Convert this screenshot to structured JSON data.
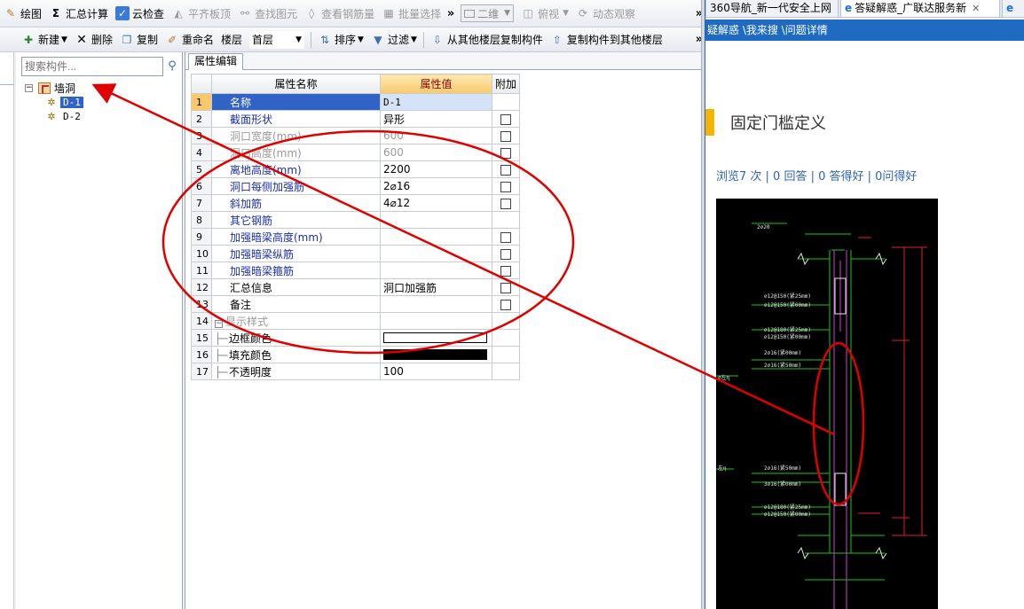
{
  "toolbar_top": {
    "items": [
      {
        "label": "绘图",
        "icon": "draw-icon",
        "enabled": true
      },
      {
        "label": "汇总计算",
        "icon": "sigma-icon",
        "enabled": true
      },
      {
        "label": "云检查",
        "icon": "cloud-check-icon",
        "enabled": true
      },
      {
        "label": "平齐板顶",
        "icon": "align-icon",
        "enabled": false
      },
      {
        "label": "查找图元",
        "icon": "binoculars-icon",
        "enabled": false
      },
      {
        "label": "查看钢筋量",
        "icon": "rebar-icon",
        "enabled": false
      },
      {
        "label": "批量选择",
        "icon": "batch-icon",
        "enabled": false
      }
    ],
    "view_mode": "二维",
    "view_angle": "俯视",
    "dynamic_view": "动态观察",
    "more": "»"
  },
  "toolbar_second": {
    "new_label": "新建",
    "delete_label": "删除",
    "copy_label": "复制",
    "rename_label": "重命名",
    "floor_label": "楼层",
    "floor_value": "首层",
    "sort_label": "排序",
    "filter_label": "过滤",
    "copy_from_label": "从其他楼层复制构件",
    "copy_to_label": "复制构件到其他楼层",
    "more": "»"
  },
  "close_glyph": "✕",
  "search": {
    "placeholder": "搜索构件..."
  },
  "tree": {
    "root_label": "墙洞",
    "children": [
      "D-1",
      "D-2"
    ]
  },
  "tab_label": "属性编辑",
  "grid": {
    "headers": {
      "name": "属性名称",
      "value": "属性值",
      "extra": "附加"
    },
    "rows": [
      {
        "num": "1",
        "name": "名称",
        "value": "D-1",
        "style": "selected",
        "checkbox": false
      },
      {
        "num": "2",
        "name": "截面形状",
        "value": "异形",
        "style": "blue",
        "checkbox": true
      },
      {
        "num": "3",
        "name": "洞口宽度(mm)",
        "value": "600",
        "style": "gray",
        "checkbox": true
      },
      {
        "num": "4",
        "name": "洞口高度(mm)",
        "value": "600",
        "style": "gray",
        "checkbox": true
      },
      {
        "num": "5",
        "name": "离地高度(mm)",
        "value": "2200",
        "style": "blue",
        "checkbox": true
      },
      {
        "num": "6",
        "name": "洞口每侧加强筋",
        "value": "2⌀16",
        "style": "blue",
        "checkbox": true
      },
      {
        "num": "7",
        "name": "斜加筋",
        "value": "4⌀12",
        "style": "blue",
        "checkbox": true
      },
      {
        "num": "8",
        "name": "其它钢筋",
        "value": "",
        "style": "blue",
        "checkbox": false
      },
      {
        "num": "9",
        "name": "加强暗梁高度(mm)",
        "value": "",
        "style": "blue",
        "checkbox": true
      },
      {
        "num": "10",
        "name": "加强暗梁纵筋",
        "value": "",
        "style": "blue",
        "checkbox": true
      },
      {
        "num": "11",
        "name": "加强暗梁箍筋",
        "value": "",
        "style": "blue",
        "checkbox": true
      },
      {
        "num": "12",
        "name": "汇总信息",
        "value": "洞口加强筋",
        "style": "black",
        "checkbox": true
      },
      {
        "num": "13",
        "name": "备注",
        "value": "",
        "style": "black",
        "checkbox": true
      },
      {
        "num": "14",
        "name": "显示样式",
        "value": "",
        "style": "group",
        "checkbox": false
      },
      {
        "num": "15",
        "name": "边框颜色",
        "value": "",
        "style": "child",
        "swatch": "#ffffff",
        "checkbox": false
      },
      {
        "num": "16",
        "name": "填充颜色",
        "value": "",
        "style": "child",
        "swatch": "#000000",
        "checkbox": false
      },
      {
        "num": "17",
        "name": "不透明度",
        "value": "100",
        "style": "child",
        "checkbox": false
      }
    ]
  },
  "browser": {
    "tabs": [
      {
        "label": "360导航_新一代安全上网"
      },
      {
        "label": "答疑解惑_广联达服务新"
      }
    ],
    "nav_text": "疑解惑 \\我来搜 \\问题详情",
    "question_title": "固定门槛定义",
    "stats": "浏览7 次 | 0 回答 | 0 答得好 | 0问得好"
  },
  "colors": {
    "selection_blue": "#3163c6",
    "header_orange": "#f9c96a",
    "annotation_red": "#e00000",
    "link_blue": "#2f64b8",
    "brand_bar": "#1f6bc1"
  }
}
